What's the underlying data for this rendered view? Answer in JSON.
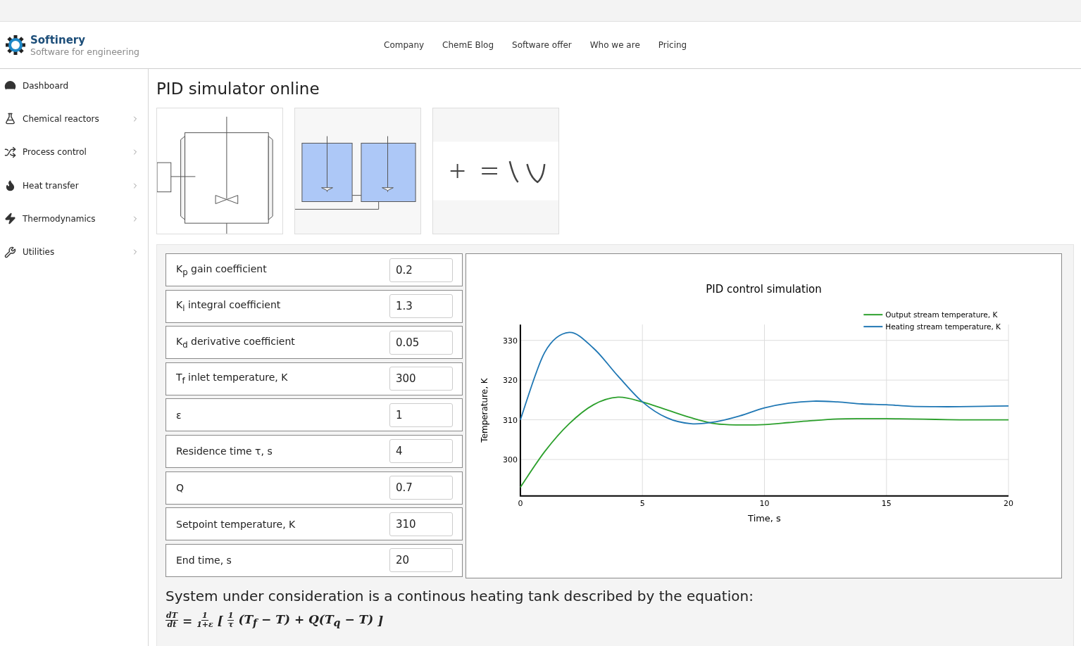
{
  "brand": {
    "name": "Softinery",
    "tagline": "Software for engineering"
  },
  "nav": [
    "Company",
    "ChemE Blog",
    "Software offer",
    "Who we are",
    "Pricing"
  ],
  "sidebar": {
    "items": [
      {
        "label": "Dashboard",
        "kind": "dashboard",
        "has_children": false
      },
      {
        "label": "Chemical reactors",
        "kind": "reactors",
        "has_children": true
      },
      {
        "label": "Process control",
        "kind": "control",
        "has_children": true
      },
      {
        "label": "Heat transfer",
        "kind": "heat",
        "has_children": true
      },
      {
        "label": "Thermodynamics",
        "kind": "thermo",
        "has_children": true
      },
      {
        "label": "Utilities",
        "kind": "utilities",
        "has_children": true
      }
    ]
  },
  "page_title": "PID simulator online",
  "thumbnails": [
    {
      "kind": "picture"
    },
    {
      "kind": "picture"
    },
    {
      "kind": "picture"
    }
  ],
  "parameters": [
    {
      "label": "K$_{p}$ gain coefficient",
      "value": "0.2"
    },
    {
      "label": "K$_{i}$ integral coefficient",
      "value": "1.3"
    },
    {
      "label": "K$_{d}$ derivative coefficient",
      "value": "0.05"
    },
    {
      "label": "T$_{f}$ inlet temperature, K",
      "value": "300"
    },
    {
      "label": "ε",
      "value": "1"
    },
    {
      "label": "Residence time τ, s",
      "value": "4"
    },
    {
      "label": "Q",
      "value": "0.7"
    },
    {
      "label": "Setpoint temperature, K",
      "value": "310"
    },
    {
      "label": "End time, s",
      "value": "20"
    }
  ],
  "chart_data": {
    "type": "line",
    "title": "PID control simulation",
    "xlabel": "Time, s",
    "ylabel": "Temperature, K",
    "x": [
      0,
      1,
      2,
      3,
      4,
      5,
      6,
      7,
      8,
      9,
      10,
      11,
      12,
      13,
      14,
      15,
      16,
      17,
      18,
      19,
      20
    ],
    "series": [
      {
        "name": "Output stream temperature, K",
        "color": "#2ca02c",
        "values": [
          293,
          302,
          309,
          313.8,
          315.7,
          314.5,
          312.5,
          310.5,
          309,
          308.7,
          308.8,
          309.3,
          309.8,
          310.2,
          310.3,
          310.3,
          310.2,
          310.1,
          310,
          310,
          310
        ]
      },
      {
        "name": "Heating stream temperature, K",
        "color": "#1f77b4",
        "values": [
          310,
          327,
          332,
          328,
          321,
          314.5,
          310.5,
          309,
          309.5,
          311,
          313,
          314.2,
          314.7,
          314.5,
          314,
          313.8,
          313.4,
          313.3,
          313.3,
          313.4,
          313.5
        ]
      }
    ],
    "grid": true,
    "legend": true,
    "xlim": [
      0,
      20
    ],
    "ylim": [
      290.8,
      334
    ],
    "xticks": [
      0,
      5,
      10,
      15,
      20
    ],
    "yticks": [
      300,
      310,
      320,
      330
    ]
  },
  "description": "System under consideration is a continous heating tank described by the equation:",
  "equation": [
    {
      "kind": "frac",
      "num": "dT",
      "den": "dt"
    },
    {
      "kind": "text",
      "text": "="
    },
    {
      "kind": "frac",
      "num": "1",
      "den": "1+ε"
    },
    {
      "kind": "text",
      "text": "["
    },
    {
      "kind": "frac",
      "num": "1",
      "den": "τ"
    },
    {
      "kind": "text",
      "text": "(T$_{f}$ − T) + Q(T$_{q}$ − T)"
    },
    {
      "kind": "text",
      "text": "]"
    }
  ]
}
